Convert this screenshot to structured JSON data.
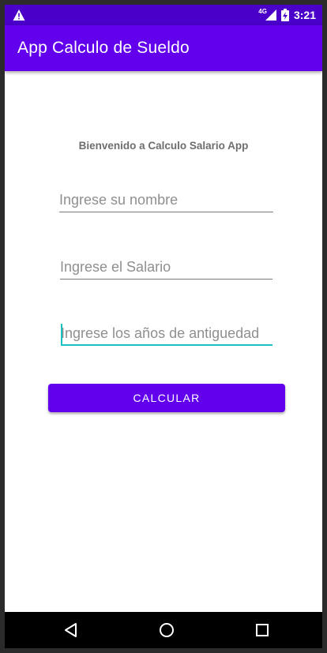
{
  "status_bar": {
    "network_label": "4G",
    "time": "3:21",
    "left_icon": "warning-icon",
    "right_icons": [
      "signal-icon",
      "battery-icon"
    ]
  },
  "app_bar": {
    "title": "App Calculo de Sueldo"
  },
  "main": {
    "welcome_text": "Bienvenido a Calculo Salario App",
    "fields": {
      "name_placeholder": "Ingrese su nombre",
      "salary_placeholder": "Ingrese el Salario",
      "seniority_placeholder": "Ingrese los años de antiguedad"
    },
    "calculate_label": "CALCULAR"
  },
  "nav_bar": {
    "icons": [
      "back-icon",
      "home-icon",
      "recents-icon"
    ]
  },
  "colors": {
    "status_bar": "#4a00c9",
    "primary": "#6200ee",
    "accent": "#18c2c2"
  }
}
